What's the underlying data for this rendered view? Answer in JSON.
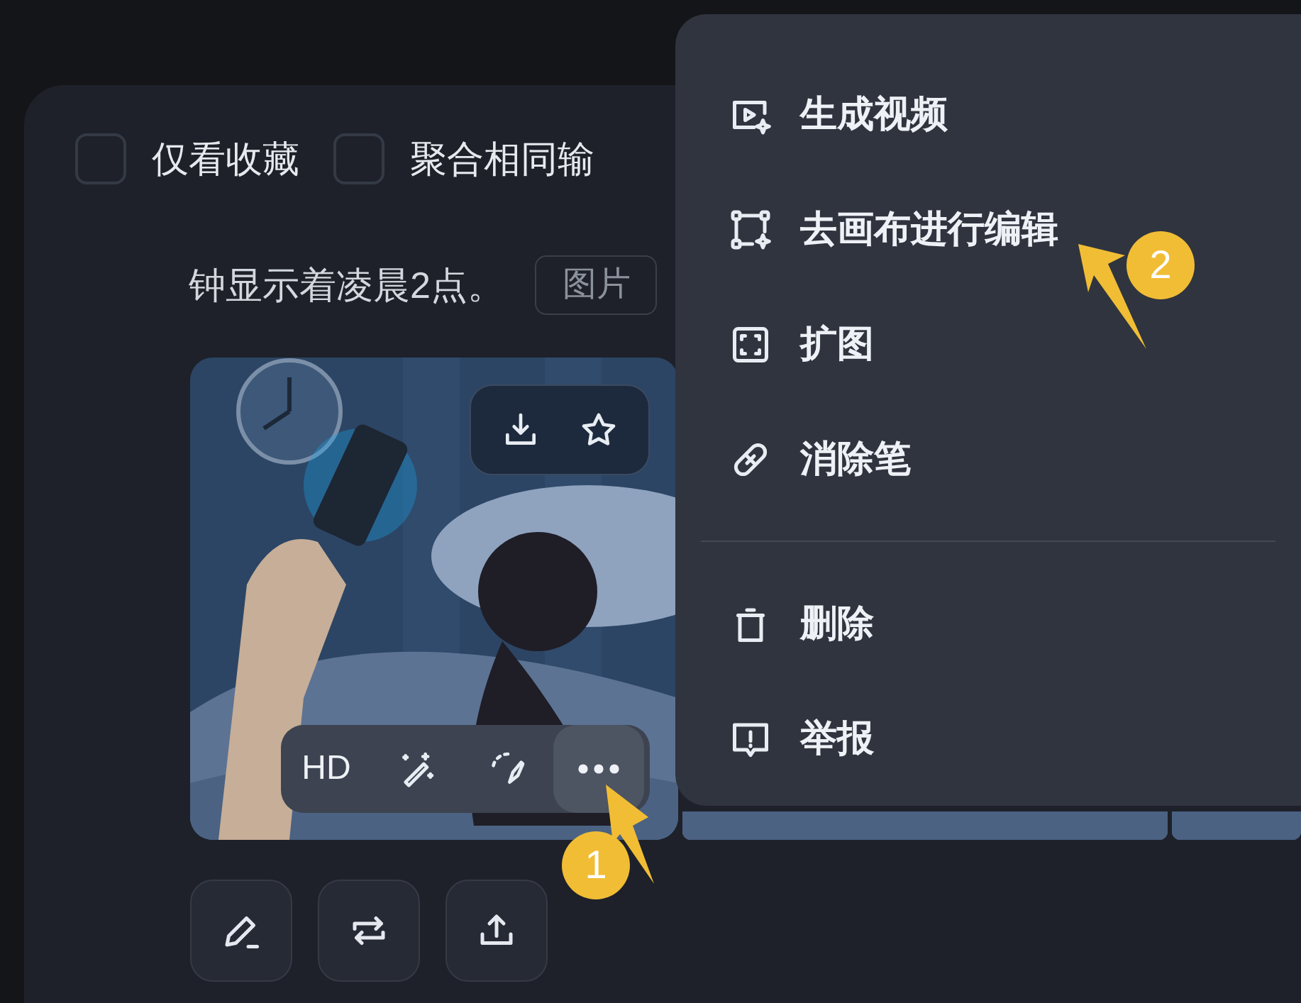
{
  "filters": [
    {
      "label": "仅看收藏",
      "checked": false
    },
    {
      "label": "聚合相同输",
      "checked": false
    }
  ],
  "prompt": {
    "text": "钟显示着凌晨2点。",
    "tag": "图片"
  },
  "image_toolbar": {
    "hd_label": "HD",
    "more_selected": true
  },
  "menu": {
    "groups": [
      [
        {
          "label": "生成视频",
          "kind": "video"
        },
        {
          "label": "去画布进行编辑",
          "kind": "canvas"
        },
        {
          "label": "扩图",
          "kind": "expand"
        },
        {
          "label": "消除笔",
          "kind": "eraser"
        }
      ],
      [
        {
          "label": "删除",
          "kind": "delete"
        },
        {
          "label": "举报",
          "kind": "report"
        }
      ]
    ]
  },
  "annotations": [
    {
      "number": "1"
    },
    {
      "number": "2"
    }
  ]
}
